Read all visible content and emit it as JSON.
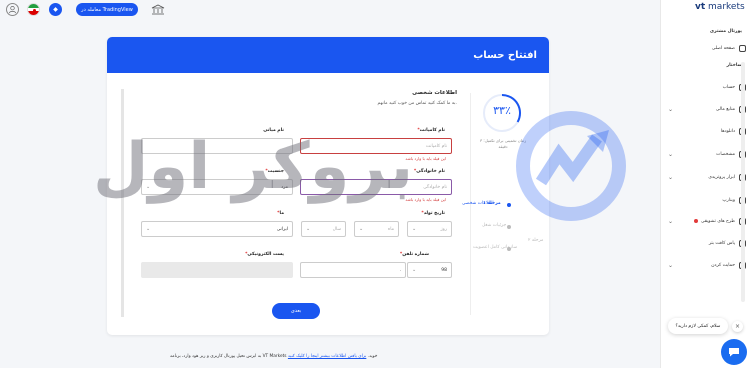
{
  "topbar": {
    "tradingview_label": "معامله در TradingView"
  },
  "brand": {
    "vt": "vt",
    "markets": " markets"
  },
  "sidebar": {
    "portal_heading": "پورتال مشتری",
    "home": "صفحه اصلی",
    "section_heading": "ساختار",
    "items": [
      {
        "label": "حساب",
        "chevron": false
      },
      {
        "label": "منابع مالی",
        "chevron": true
      },
      {
        "label": "دانلودها",
        "chevron": false
      },
      {
        "label": "مشخصات",
        "chevron": true
      },
      {
        "label": "ابزار پروتریدی",
        "chevron": true
      },
      {
        "label": "وبنارپ",
        "chevron": false
      },
      {
        "label": "طرح های تشویقی",
        "chevron": true,
        "dot": true
      },
      {
        "label": "پاس کافت بتر",
        "chevron": false
      },
      {
        "label": "حمایت کردن",
        "chevron": true
      }
    ]
  },
  "card": {
    "title": "افتتاح حساب",
    "progress": {
      "percent": "۳۳٪",
      "note": "زمان تخمینی برای تکمیل: ۳ دقیقه"
    },
    "steps": [
      {
        "num": "مرحله ۱",
        "label": "اطلاعات شخصی",
        "active": true
      },
      {
        "num": "",
        "label": "جزئیات شغل",
        "active": false
      },
      {
        "num": "مرحله ۲",
        "label": "سازمانی کامل اعضویت",
        "active": false
      }
    ],
    "section_title": "اطلاعات شخصی",
    "section_desc": "به ما کمک کنید تماس من خوب کنید مانهم.",
    "fields": {
      "first_name": {
        "label": "نام کامپانت",
        "placeholder": "نام کامپانت",
        "error": "این فیلد باید با وارد باشد"
      },
      "middle_name": {
        "label": "نام میانی",
        "placeholder": ""
      },
      "last_name": {
        "label": "نام خانوادگی",
        "placeholder": "نام خانوادگی",
        "error": "این فیلد باید با وارد باشد"
      },
      "gender": {
        "label": "جنسیت",
        "value": "مرد"
      },
      "dob": {
        "label": "تاریخ تولد",
        "day": "روز",
        "month": "ماه",
        "year": "سال"
      },
      "country": {
        "label": "ما",
        "value": "ایرانی"
      },
      "phone": {
        "label": "شماره تلفن",
        "code": "98",
        "value": "."
      },
      "email": {
        "label": "پست الکترونیکی",
        "value": ""
      }
    },
    "submit": "بعدی"
  },
  "footer": {
    "text": "به ابرس تحیل پورتال کاربری و ربر هود وارد، برنامه VT Markets خوید.",
    "link": "برای یافتن اطلاعات بیشتر اینجا را کلیک کنید"
  },
  "watermark": "بروکر اول",
  "chat": {
    "message": "سلام، کمکی لازم دارید؟",
    "close": "×"
  },
  "colors": {
    "accent": "#1a56f0",
    "error": "#d23a3a",
    "navy": "#1a3b7c"
  }
}
